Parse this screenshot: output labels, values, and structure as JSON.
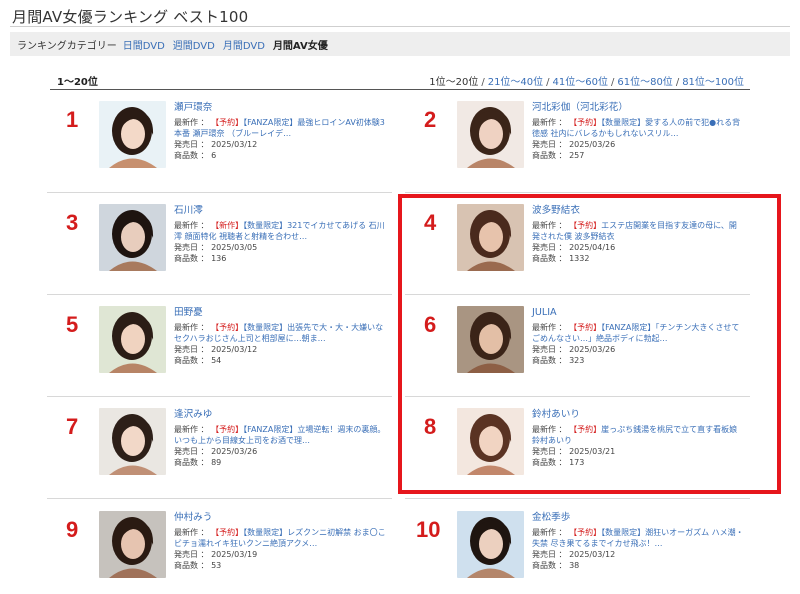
{
  "page": {
    "title": "月間AV女優ランキング ベスト100"
  },
  "categories": {
    "label": "ランキングカテゴリー",
    "links": [
      "日間DVD",
      "週間DVD",
      "月間DVD"
    ],
    "current": "月間AV女優"
  },
  "range": {
    "current_left": "1〜20位",
    "current_right": "1位〜20位",
    "links": [
      "21位〜40位",
      "41位〜60位",
      "61位〜80位",
      "81位〜100位"
    ],
    "separator": "/"
  },
  "labels": {
    "newest": "最新作",
    "release": "発売日",
    "count": "商品数",
    "colon": "："
  },
  "colors": {
    "accent_red": "#d41c1c",
    "link_blue": "#3a6fb7",
    "highlight_red": "#e6161c"
  },
  "entries": [
    {
      "rank": "1",
      "name": "瀬戸環奈",
      "tags": [
        {
          "text": "【予約】",
          "color": "red"
        },
        {
          "text": "【FANZA限定】",
          "color": "blue"
        }
      ],
      "work": "最強ヒロインAV初体験3本番 瀬戸環奈 （ブルーレイデ…",
      "release": "2025/03/12",
      "count": "6"
    },
    {
      "rank": "2",
      "name": "河北彩伽（河北彩花）",
      "tags": [
        {
          "text": "【予約】",
          "color": "red"
        },
        {
          "text": "【数量限定】",
          "color": "blue"
        }
      ],
      "work": "愛する人の前で犯●れる背徳感 社内にバレるかもしれないスリル…",
      "release": "2025/03/26",
      "count": "257"
    },
    {
      "rank": "3",
      "name": "石川澪",
      "tags": [
        {
          "text": "【新作】",
          "color": "red"
        },
        {
          "text": "【数量限定】",
          "color": "blue"
        }
      ],
      "work": "321でイカせてあげる 石川澪 顔面特化 視聴者と射精を合わせ…",
      "release": "2025/03/05",
      "count": "136"
    },
    {
      "rank": "4",
      "name": "波多野結衣",
      "tags": [
        {
          "text": "【予約】",
          "color": "red"
        }
      ],
      "work": "エステ店開業を目指す友達の母に、開発された僕 波多野結衣",
      "release": "2025/04/16",
      "count": "1332"
    },
    {
      "rank": "5",
      "name": "田野憂",
      "tags": [
        {
          "text": "【予約】",
          "color": "red"
        },
        {
          "text": "【数量限定】",
          "color": "blue"
        }
      ],
      "work": "出張先で大・大・大嫌いなセクハラおじさん上司と相部屋に…朝ま…",
      "release": "2025/03/12",
      "count": "54"
    },
    {
      "rank": "6",
      "name": "JULIA",
      "tags": [
        {
          "text": "【予約】",
          "color": "red"
        },
        {
          "text": "【FANZA限定】",
          "color": "blue"
        }
      ],
      "work": "「チンチン大きくさせてごめんなさい…」絶品ボディに勃起…",
      "release": "2025/03/26",
      "count": "323"
    },
    {
      "rank": "7",
      "name": "逢沢みゆ",
      "tags": [
        {
          "text": "【予約】",
          "color": "red"
        },
        {
          "text": "【FANZA限定】",
          "color": "blue"
        }
      ],
      "work": "立場逆転！週末の裏顔。いつも上から目線女上司をお酒で理…",
      "release": "2025/03/26",
      "count": "89"
    },
    {
      "rank": "8",
      "name": "鈴村あいり",
      "tags": [
        {
          "text": "【予約】",
          "color": "red"
        }
      ],
      "work": "崖っぷち銭湯を桃尻で立て直す看板娘 鈴村あいり",
      "release": "2025/03/21",
      "count": "173"
    },
    {
      "rank": "9",
      "name": "仲村みう",
      "tags": [
        {
          "text": "【予約】",
          "color": "red"
        },
        {
          "text": "【数量限定】",
          "color": "blue"
        }
      ],
      "work": "レズクンニ初解禁 おま〇こビチョ濡れイキ狂いクンニ絶頂アクメ…",
      "release": "2025/03/19",
      "count": "53"
    },
    {
      "rank": "10",
      "name": "金松季歩",
      "tags": [
        {
          "text": "【予約】",
          "color": "red"
        },
        {
          "text": "【数量限定】",
          "color": "blue"
        }
      ],
      "work": "潮狂いオーガズム ハメ潮・失禁 尽き果てるまでイカせ飛ぶ！…",
      "release": "2025/03/12",
      "count": "38"
    }
  ]
}
